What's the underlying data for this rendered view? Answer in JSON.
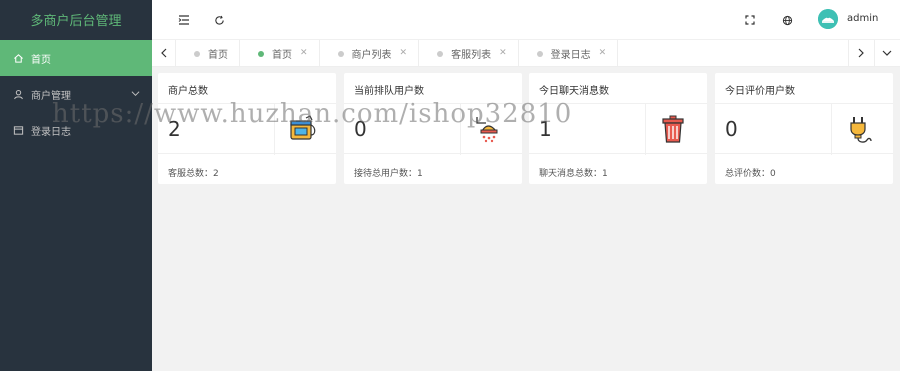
{
  "app": {
    "title": "多商户后台管理"
  },
  "sidebar": {
    "items": [
      {
        "label": "首页",
        "icon": "home-icon"
      },
      {
        "label": "商户管理",
        "icon": "user-icon"
      },
      {
        "label": "登录日志",
        "icon": "log-icon"
      }
    ]
  },
  "header": {
    "username": "admin"
  },
  "tabs": [
    {
      "label": "首页",
      "active": false,
      "closable": false
    },
    {
      "label": "首页",
      "active": true,
      "closable": true
    },
    {
      "label": "商户列表",
      "active": false,
      "closable": true
    },
    {
      "label": "客服列表",
      "active": false,
      "closable": true
    },
    {
      "label": "登录日志",
      "active": false,
      "closable": true
    }
  ],
  "cards": [
    {
      "title": "商户总数",
      "value": "2",
      "footer": "客服总数：2",
      "icon": "paint-bucket-icon"
    },
    {
      "title": "当前排队用户数",
      "value": "0",
      "footer": "接待总用户数：1",
      "icon": "shower-icon"
    },
    {
      "title": "今日聊天消息数",
      "value": "1",
      "footer": "聊天消息总数：1",
      "icon": "trash-can-icon"
    },
    {
      "title": "今日评价用户数",
      "value": "0",
      "footer": "总评价数：0",
      "icon": "plug-icon"
    }
  ],
  "watermark": "https://www.huzhan.com/ishop32810",
  "colors": {
    "sidebar_bg": "#28333e",
    "accent": "#5fb878",
    "content_bg": "#f2f2f2"
  }
}
